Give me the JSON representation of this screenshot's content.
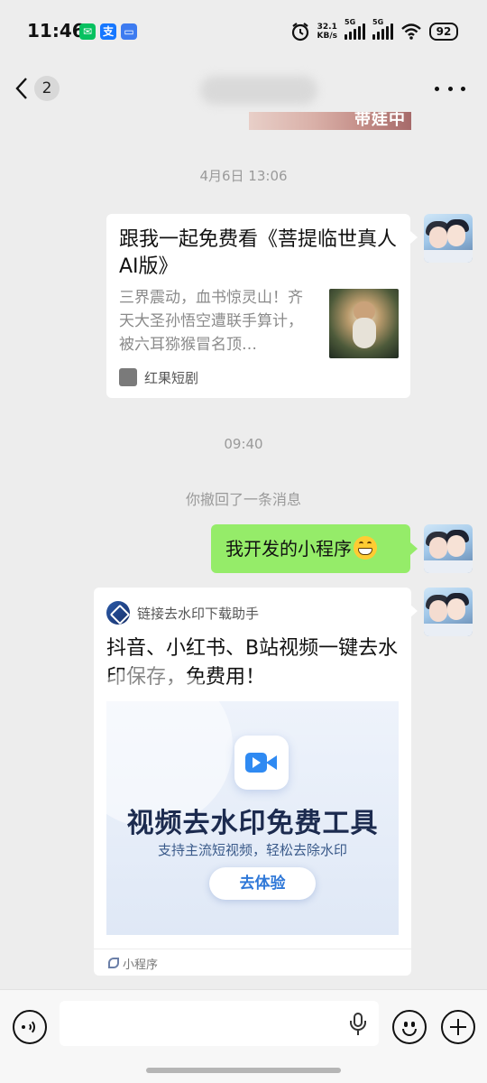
{
  "status_bar": {
    "time": "11:46",
    "net_speed_value": "32.1",
    "net_speed_unit": "KB/s",
    "signal1_label": "5G",
    "signal2_label": "5G",
    "battery": "92",
    "notif_icons": [
      "wechat-icon",
      "alipay-icon",
      "message-icon"
    ],
    "colors": {
      "wechat": "#07c160",
      "alipay": "#1677ff",
      "message": "#3d7bf0"
    }
  },
  "nav": {
    "unread_count": "2"
  },
  "cropped_image": {
    "text": "带娃中"
  },
  "messages": {
    "time1": "4月6日 13:06",
    "link_card": {
      "title": "跟我一起免费看《菩提临世真人AI版》",
      "description": "三界震动，血书惊灵山！齐天大圣孙悟空遭联手算计，被六耳猕猴冒名顶…",
      "source": "红果短剧"
    },
    "time2": "09:40",
    "recall_notice": "你撤回了一条消息",
    "text_message": "我开发的小程序",
    "mini_program": {
      "name": "链接去水印下载助手",
      "title": "抖音、小红书、B站视频一键去水印保存，免费用！",
      "banner_title": "视频去水印免费工具",
      "banner_subtitle": "支持主流短视频，轻松去除水印",
      "banner_button": "去体验",
      "footer_label": "小程序"
    }
  },
  "input_bar": {
    "placeholder": ""
  },
  "colors": {
    "background": "#ededed",
    "sent_bubble": "#95ec69",
    "accent_blue": "#2f8af2"
  }
}
